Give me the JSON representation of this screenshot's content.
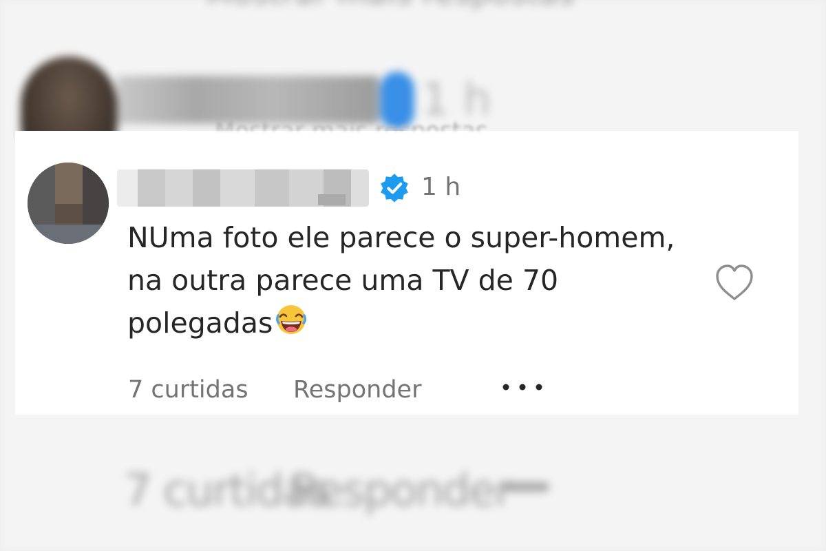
{
  "background_echo": {
    "top_text": "Mostrar mais respostas",
    "time": "1 h",
    "likes": "7 curtidas",
    "reply": "Responder"
  },
  "comment": {
    "show_more": "Mostrar mais respostas",
    "time": "1 h",
    "text": "NUma foto ele parece o super-homem, na outra parece uma TV de 70 polegadas",
    "emoji": "rolling-on-floor-laughing-emoji",
    "likes": "7 curtidas",
    "reply_label": "Responder",
    "more_icon": "more-options-icon",
    "verified_color": "#1d9bf0",
    "text_color": "#262626",
    "meta_color": "#737373"
  }
}
